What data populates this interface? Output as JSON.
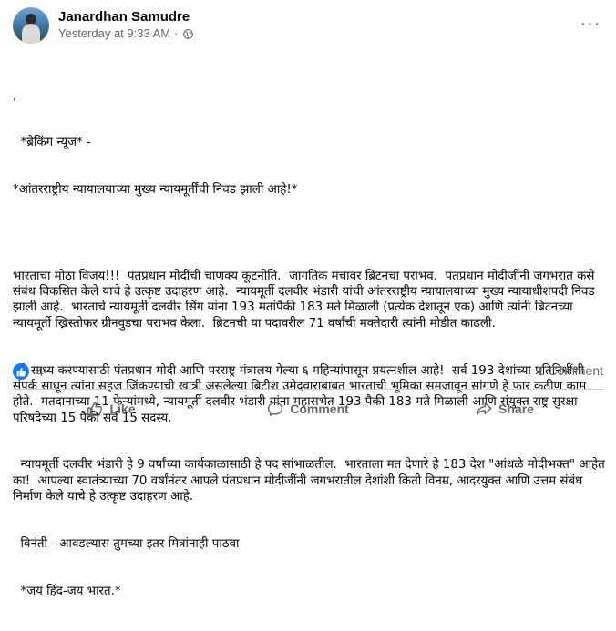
{
  "post": {
    "author": "Janardhan Samudre",
    "timestamp": "Yesterday at 9:33 AM",
    "separator": "·",
    "privacy_icon": "globe-icon",
    "more_label": "···",
    "lines": {
      "l0": ",",
      "l1": "  *ब्रेकिंग न्यूज* -",
      "l2": "*आंतरराष्ट्रीय न्यायालयाच्या मुख्य न्यायमूर्तींची निवड झाली आहे!*",
      "p1": "भारताचा मोठा विजय!!!  पंतप्रधान मोदींची चाणक्य कूटनीति.  जागतिक मंचावर ब्रिटनचा पराभव.  पंतप्रधान मोदीजींनी जगभरात कसे संबंध विकसित केले याचे हे उत्कृष्ट उदाहरण आहे.  न्यायमूर्ती दलवीर भंडारी यांची आंतरराष्ट्रीय न्यायालयाच्या मुख्य न्यायाधीशपदी निवड झाली आहे.  भारताचे न्यायमूर्ती दलवीर सिंग यांना 193 मतांपैकी 183 मते मिळाली (प्रत्येक देशातून एक) आणि त्यांनी ब्रिटनच्या न्यायमूर्ती ख्रिस्तोफर ग्रीनवुडचा पराभव केला.  ब्रिटनची या पदावरील 71 वर्षांची मक्तेदारी त्यांनी मोडीत काढली.",
      "p2": "  हे साध्य करण्यासाठी पंतप्रधान मोदी आणि परराष्ट्र मंत्रालय गेल्या ६ महिन्यांपासून प्रयत्नशील आहे!  सर्व 193 देशांच्या प्रतिनिधींशी संपर्क साधून त्यांना सहज जिंकण्याची खात्री असलेल्या ब्रिटीश उमेदवाराबाबत भारताची भूमिका समजावून सांगणे हे फार कठीण काम होते.  मतदानाच्या 11 फेऱ्यांमध्ये, न्यायमूर्ती दलवीर भंडारी यांना महासभेत 193 पैकी 183 मते मिळाली आणि संयुक्त राष्ट्र सुरक्षा परिषदेच्या 15 पैकी सर्व 15 सदस्य.",
      "p3": "  न्यायमूर्ती दलवीर भंडारी हे 9 वर्षांच्या कार्यकाळासाठी हे पद सांभाळतील.  भारताला मत देणारे हे 183 देश \"आंधळे मोदीभक्त\" आहेत का!  आपल्या स्वातंत्र्याच्या 70 वर्षांनंतर आपले पंतप्रधान मोदीजींनी जगभरातील देशांशी किती विनम्र, आदरयुक्त आणि उत्तम संबंध निर्माण केले याचे हे उत्कृष्ट उदाहरण आहे.",
      "p4": "  विनंती - आवडल्यास तुमच्या इतर मित्रांनाही पाठवा",
      "p5": "  *जय हिंद-जय भारत.*"
    }
  },
  "engagement": {
    "reaction_icon": "like-icon",
    "reaction_count": "4",
    "comments_label": "1 Comment"
  },
  "actions": {
    "like": "Like",
    "comment": "Comment",
    "share": "Share"
  },
  "colors": {
    "accent": "#1877f2",
    "secondary_text": "#65676b",
    "divider": "#ced0d4"
  }
}
